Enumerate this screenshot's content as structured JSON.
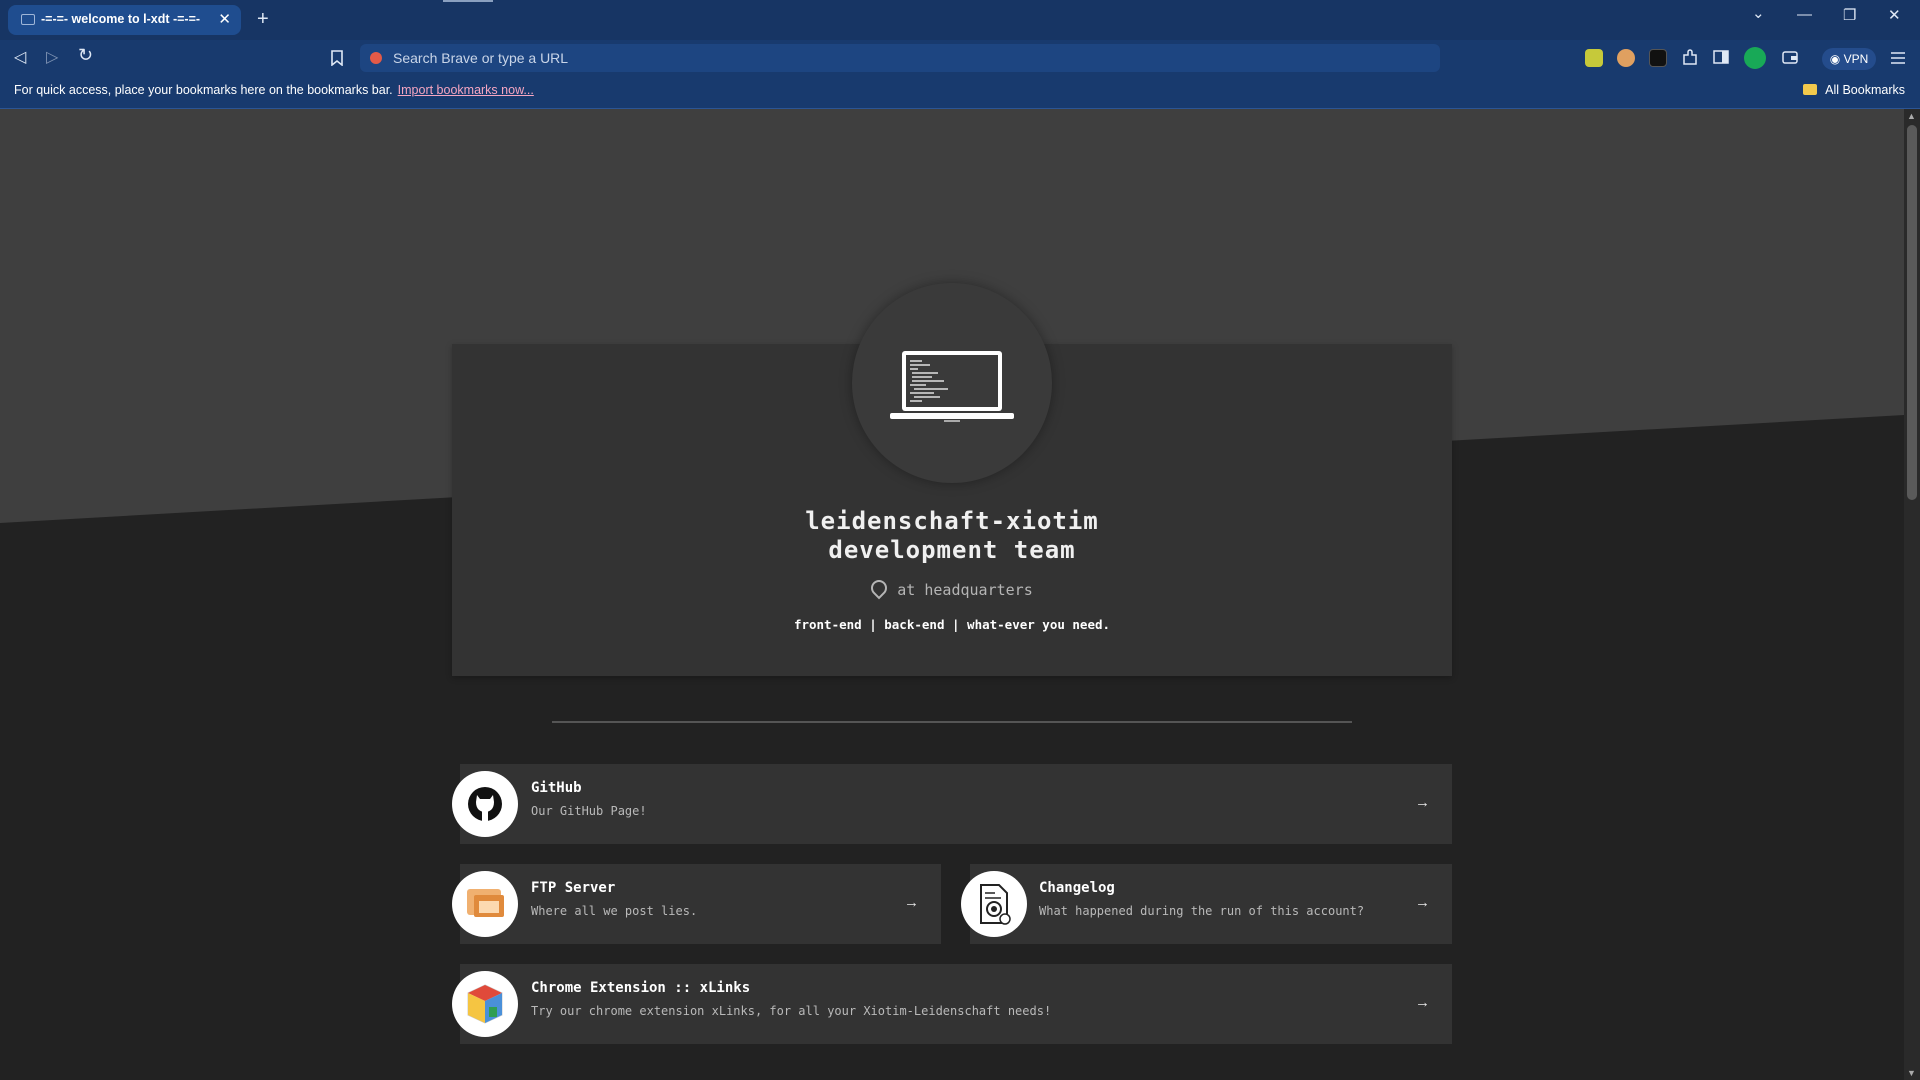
{
  "browser": {
    "tab_title": "-=-=- welcome to l-xdt -=-=-",
    "tab_close": "✕",
    "new_tab": "+",
    "omnibox_placeholder": "Search Brave or type a URL",
    "vpn_label": "VPN",
    "window_buttons": {
      "dropdown": "⌄",
      "minimize": "—",
      "restore": "❐",
      "close": "✕"
    },
    "nav": {
      "back": "◁",
      "forward": "▷",
      "reload": "↻",
      "bookmark": "🔖"
    },
    "bookmarks_bar": {
      "message": "For quick access, place your bookmarks here on the bookmarks bar.",
      "import_link": "Import bookmarks now...",
      "all_bookmarks": "All Bookmarks"
    }
  },
  "hero": {
    "title_line1": "leidenschaft-xiotim",
    "title_line2": "development team",
    "location": "at headquarters",
    "tagline": "front-end | back-end | what-ever you need."
  },
  "links": [
    {
      "title": "GitHub",
      "description": "Our GitHub Page!",
      "icon": "github-icon",
      "arrow": "→"
    },
    {
      "title": "FTP Server",
      "description": "Where all we post lies.",
      "icon": "ftp-server-icon",
      "arrow": "→"
    },
    {
      "title": "Changelog",
      "description": "What happened during the run of this account?",
      "icon": "changelog-document-icon",
      "arrow": "→"
    },
    {
      "title": "Chrome Extension :: xLinks",
      "description": "Try our chrome extension xLinks, for all your Xiotim-Leidenschaft needs!",
      "icon": "chrome-extension-box-icon",
      "arrow": "→"
    }
  ],
  "colors": {
    "chrome_bg": "#183a6e",
    "omnibox_bg": "#1d4581",
    "page_bg": "#222222",
    "hero_panel": "#333333",
    "accent_link": "#f6a6c2"
  }
}
